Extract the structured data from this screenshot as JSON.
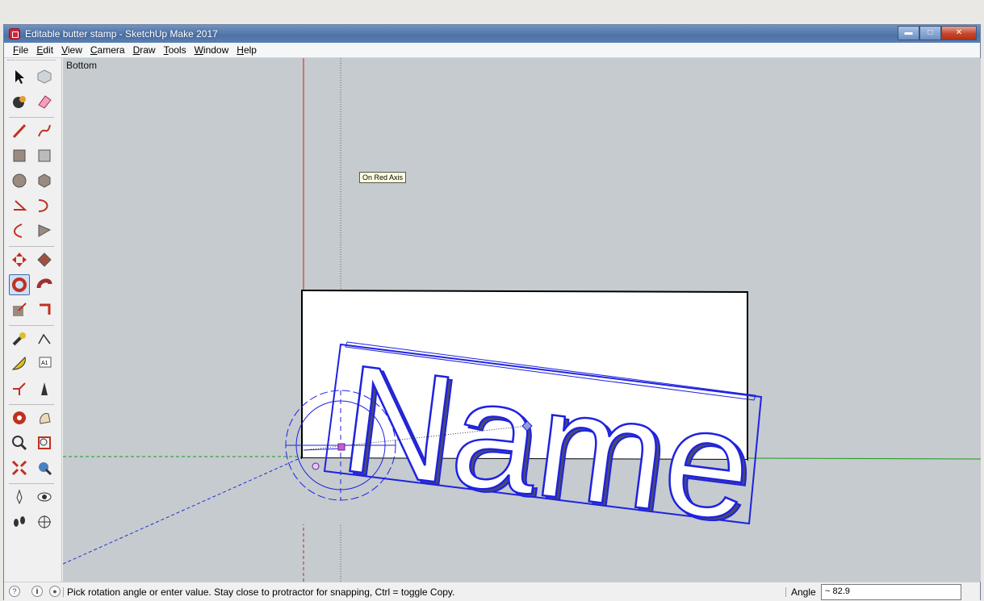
{
  "window": {
    "title": "Editable butter stamp - SketchUp Make 2017"
  },
  "menu": [
    {
      "label": "File",
      "key": "F",
      "rest": "ile"
    },
    {
      "label": "Edit",
      "key": "E",
      "rest": "dit"
    },
    {
      "label": "View",
      "key": "V",
      "rest": "iew"
    },
    {
      "label": "Camera",
      "key": "C",
      "rest": "amera"
    },
    {
      "label": "Draw",
      "key": "D",
      "rest": "raw"
    },
    {
      "label": "Tools",
      "key": "T",
      "rest": "ools"
    },
    {
      "label": "Window",
      "key": "W",
      "rest": "indow"
    },
    {
      "label": "Help",
      "key": "H",
      "rest": "elp"
    }
  ],
  "toolbar": {
    "active_tool": "rotate",
    "tools": [
      "select",
      "component",
      "paint-bucket",
      "eraser",
      "line",
      "freehand",
      "rectangle",
      "rotated-rectangle",
      "circle",
      "polygon",
      "arc",
      "pie",
      "two-point-arc",
      "three-point-arc",
      "move",
      "push-pull",
      "rotate",
      "follow-me",
      "scale",
      "offset",
      "tape-measure",
      "dimension",
      "protractor",
      "text",
      "axes",
      "3d-text",
      "orbit",
      "pan",
      "zoom",
      "zoom-window",
      "zoom-extents",
      "previous",
      "position-camera",
      "look-around",
      "walk",
      "section-plane"
    ]
  },
  "viewport": {
    "view_name": "Bottom",
    "tooltip": "On Red Axis",
    "model_text": "Name"
  },
  "status": {
    "message": "Pick rotation angle or enter value.  Stay close to protractor for snapping, Ctrl = toggle Copy.",
    "measurement_label": "Angle",
    "measurement_value": "~ 82.9"
  },
  "colors": {
    "viewport_bg": "#c5cbcf",
    "selection": "#1f22e0",
    "red_axis": "#cc2020",
    "green_axis": "#1a9a1a",
    "blue_axis": "#2030d0"
  }
}
